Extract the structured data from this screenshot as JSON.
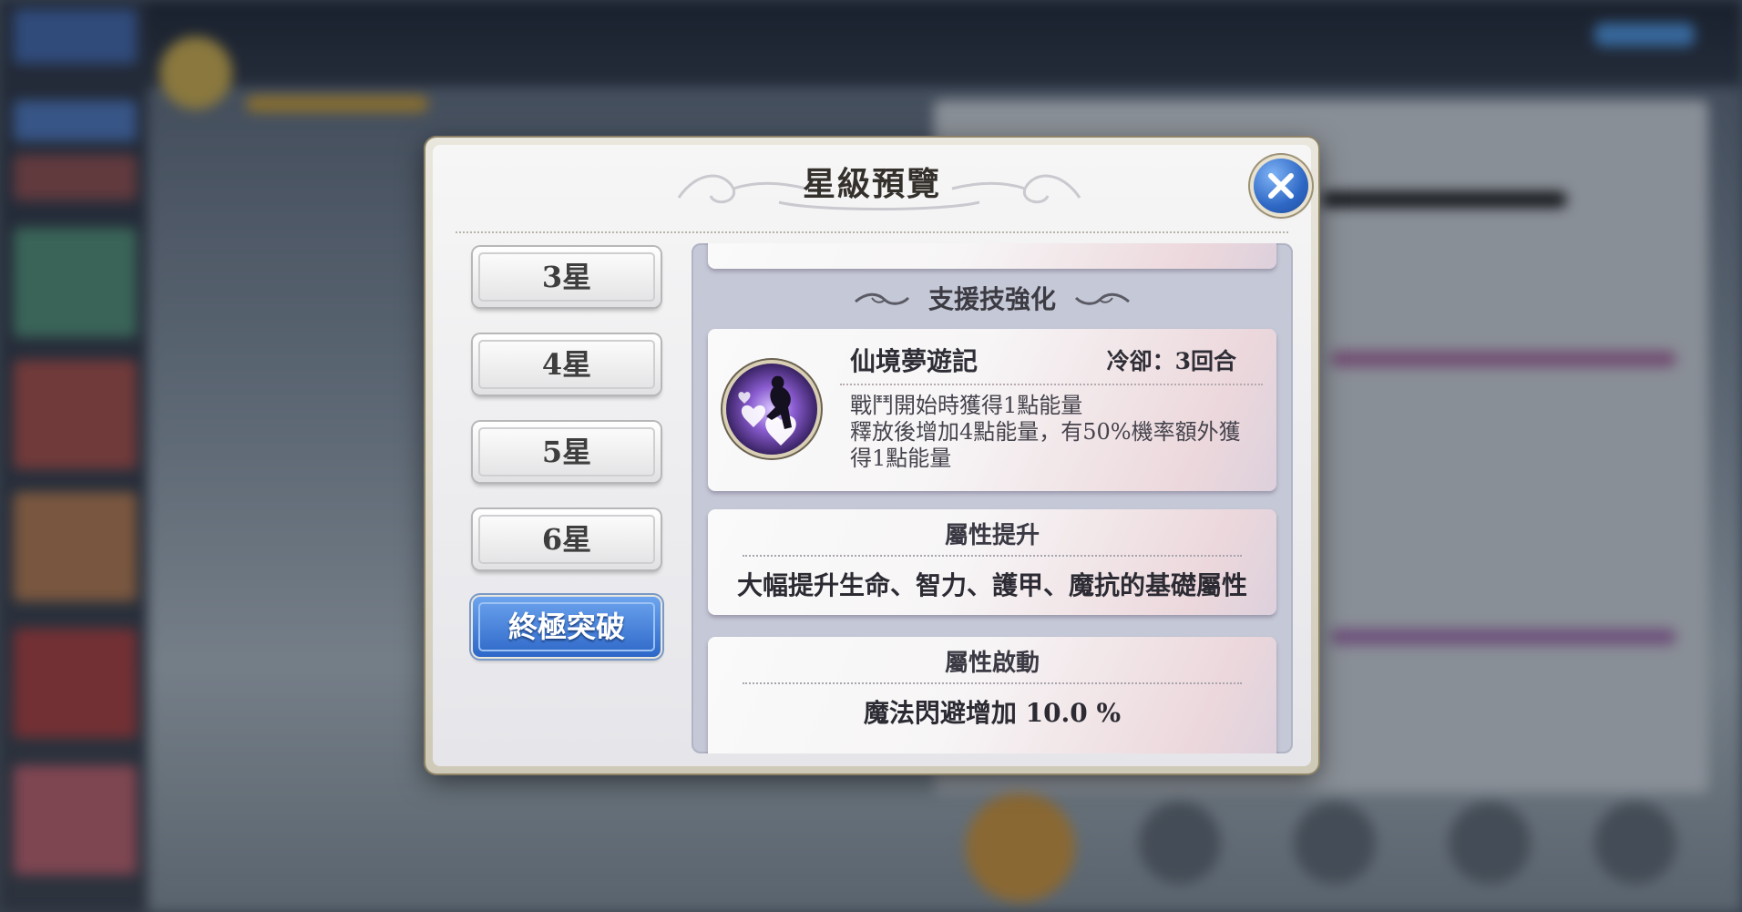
{
  "dialog": {
    "title": "星級預覽",
    "close_label": "close"
  },
  "tabs": [
    {
      "label": "3星",
      "active": false
    },
    {
      "label": "4星",
      "active": false
    },
    {
      "label": "5星",
      "active": false
    },
    {
      "label": "6星",
      "active": false
    },
    {
      "label": "終極突破",
      "active": true
    }
  ],
  "support_section": {
    "title": "支援技強化",
    "skill": {
      "icon": "silhouette-hearts-icon",
      "name": "仙境夢遊記",
      "cooldown": "冷卻：3回合",
      "desc_lines": [
        "戰鬥開始時獲得1點能量",
        "釋放後增加4點能量，有50%機率額外獲",
        "得1點能量"
      ]
    }
  },
  "attr_boost": {
    "title": "屬性提升",
    "body": "大幅提升生命、智力、護甲、魔抗的基礎屬性"
  },
  "attr_activate": {
    "title": "屬性啟動",
    "body": "魔法閃避增加 10.0 %"
  },
  "colors": {
    "accent_blue": "#2d67c8",
    "panel_bg": "#c5c8d6",
    "frame_gold": "#8e8367"
  }
}
